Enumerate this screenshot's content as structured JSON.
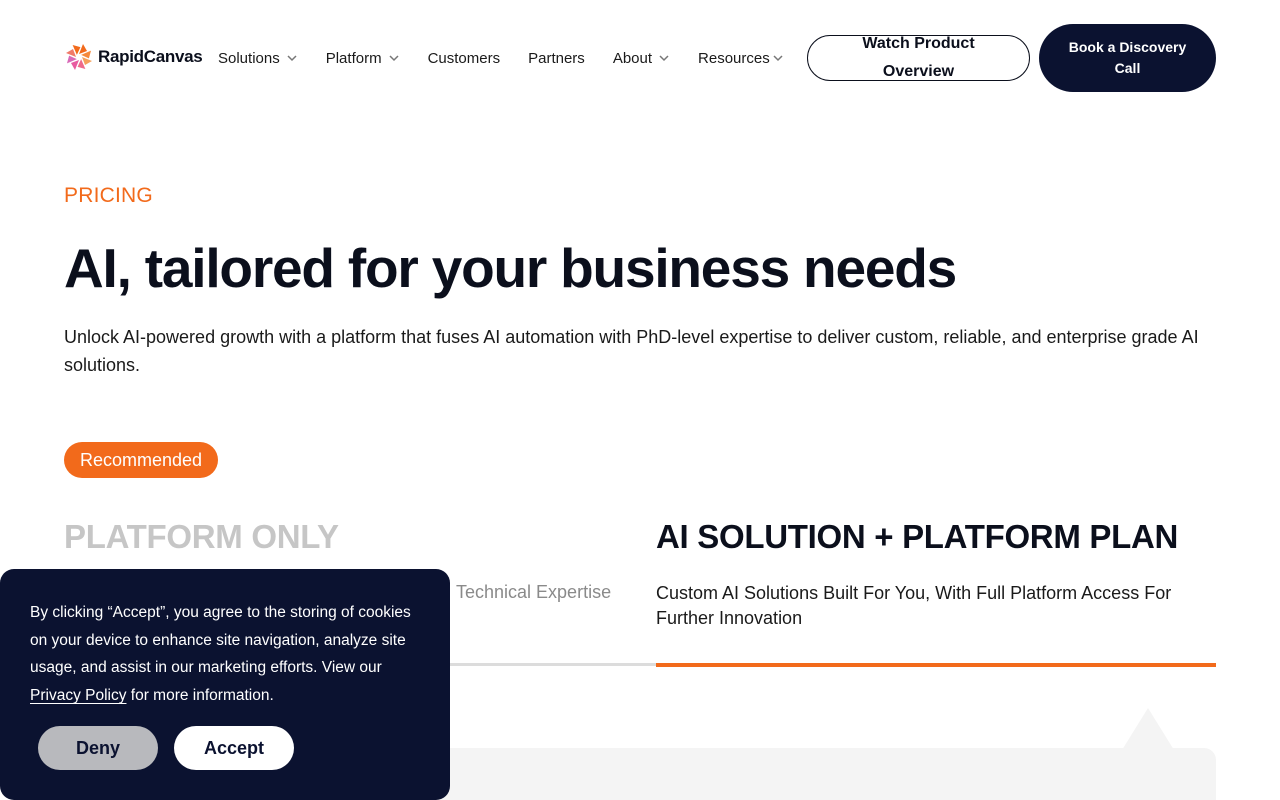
{
  "brand": {
    "name": "RapidCanvas",
    "logo_icon": "rapidcanvas-flower-icon"
  },
  "nav": {
    "items": [
      {
        "label": "Solutions",
        "has_dropdown": true
      },
      {
        "label": "Platform",
        "has_dropdown": true
      },
      {
        "label": "Customers",
        "has_dropdown": false
      },
      {
        "label": "Partners",
        "has_dropdown": false
      },
      {
        "label": "About",
        "has_dropdown": true
      },
      {
        "label": "Resources",
        "has_dropdown": true
      }
    ],
    "watch_label": "Watch Product Overview",
    "book_label": "Book a Discovery Call"
  },
  "hero": {
    "eyebrow": "PRICING",
    "title": "AI, tailored for your business needs",
    "subtitle": "Unlock AI-powered growth with a platform that fuses AI automation with PhD-level expertise to deliver custom, reliable, and enterprise grade AI solutions."
  },
  "badge": "Recommended",
  "plans": {
    "left": {
      "title": "PLATFORM ONLY",
      "subtitle": "Technical Expertise"
    },
    "right": {
      "title": "AI SOLUTION + PLATFORM PLAN",
      "subtitle": "Custom AI Solutions Built For You, With Full Platform Access For Further Innovation"
    }
  },
  "cookie": {
    "text_before": "By clicking “Accept”, you agree to the storing of cookies on your device to enhance site navigation, analyze site usage, and assist in our marketing efforts. View our ",
    "link_label": "Privacy Policy",
    "text_after": " for more information.",
    "deny_label": "Deny",
    "accept_label": "Accept"
  },
  "colors": {
    "accent": "#f26a1b",
    "navy": "#0b1230",
    "muted": "#c6c6c6"
  }
}
